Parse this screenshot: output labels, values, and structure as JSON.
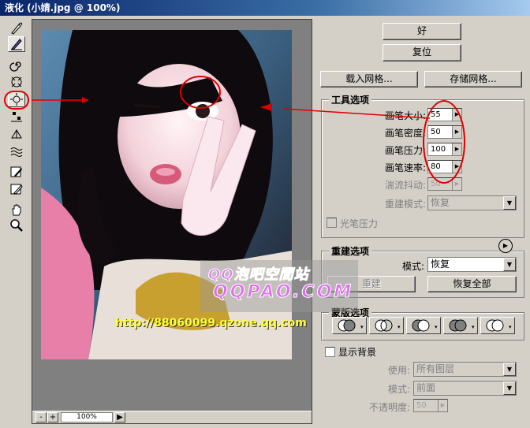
{
  "window": {
    "title": "液化 (小婧.jpg @ 100%)"
  },
  "tools": [
    "warp-icon",
    "reconstruct-icon",
    "twirl-icon",
    "pucker-icon",
    "bloat-icon",
    "shift-pixels-icon",
    "reflection-icon",
    "turbulence-icon",
    "freeze-mask-icon",
    "thaw-mask-icon",
    "hand-icon",
    "zoom-icon"
  ],
  "canvas": {
    "zoom": "100%",
    "zoom_minus": "-",
    "zoom_plus": "+",
    "zoom_menu": "▶"
  },
  "buttons": {
    "ok": "好",
    "reset": "复位",
    "load_mesh": "载入网格...",
    "save_mesh": "存储网格..."
  },
  "tool_options": {
    "title": "工具选项",
    "brush_size_label": "画笔大小:",
    "brush_size": "55",
    "brush_density_label": "画笔密度:",
    "brush_density": "50",
    "brush_pressure_label": "画笔压力:",
    "brush_pressure": "100",
    "brush_rate_label": "画笔速率:",
    "brush_rate": "80",
    "turbulent_jitter_label": "湍流抖动:",
    "turbulent_jitter": "50",
    "reconstruct_mode_label": "重建模式:",
    "reconstruct_mode": "恢复",
    "stylus_pressure_label": "光笔压力"
  },
  "reconstruct_options": {
    "title": "重建选项",
    "mode_label": "模式:",
    "mode": "恢复",
    "reconstruct": "重建",
    "restore_all": "恢复全部"
  },
  "mask_options": {
    "title": "蒙版选项"
  },
  "view_options": {
    "show_backdrop_label": "显示背景",
    "use_label": "使用:",
    "use": "所有图层",
    "mode_label": "模式:",
    "mode": "前面",
    "opacity_label": "不透明度:",
    "opacity": "50"
  },
  "watermark": {
    "line1": "QQ泡吧空間站",
    "line2": "QQPAO.COM",
    "url": "http://88060099.qzone.qq.com"
  },
  "colors": {
    "titlebar": "#0a246a",
    "annotation": "#e00000",
    "panel": "#d4d0c8"
  }
}
